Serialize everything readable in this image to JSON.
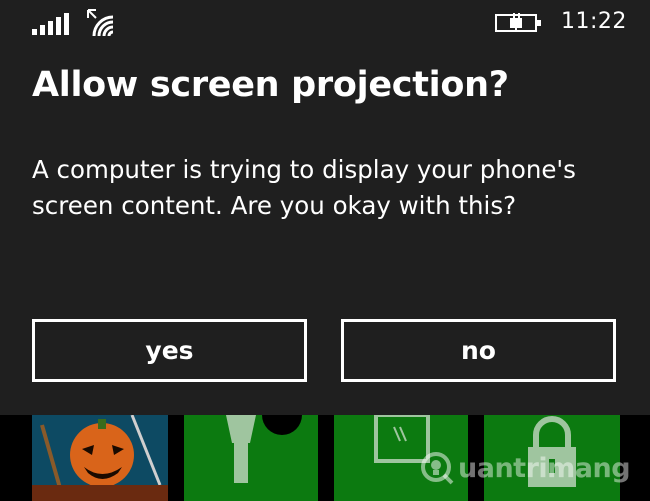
{
  "status_bar": {
    "time": "11:22",
    "icons": [
      "signal-strength-icon",
      "wifi-icon",
      "battery-charging-icon"
    ]
  },
  "dialog": {
    "title": "Allow screen projection?",
    "message": "A computer is trying to display your phone's screen content. Are you okay with this?",
    "yes_label": "yes",
    "no_label": "no"
  },
  "tiles": {
    "icons": [
      "game-tile-icon",
      "flashlight-icon",
      "notes-icon",
      "lock-icon"
    ],
    "accent": "#0c7a10"
  },
  "watermark": {
    "text": "uantrimang",
    "logo": "Q"
  },
  "colors": {
    "dialog_bg": "#1f1f1f",
    "background": "#000000",
    "text": "#ffffff",
    "tile_green": "#0c7a10"
  }
}
